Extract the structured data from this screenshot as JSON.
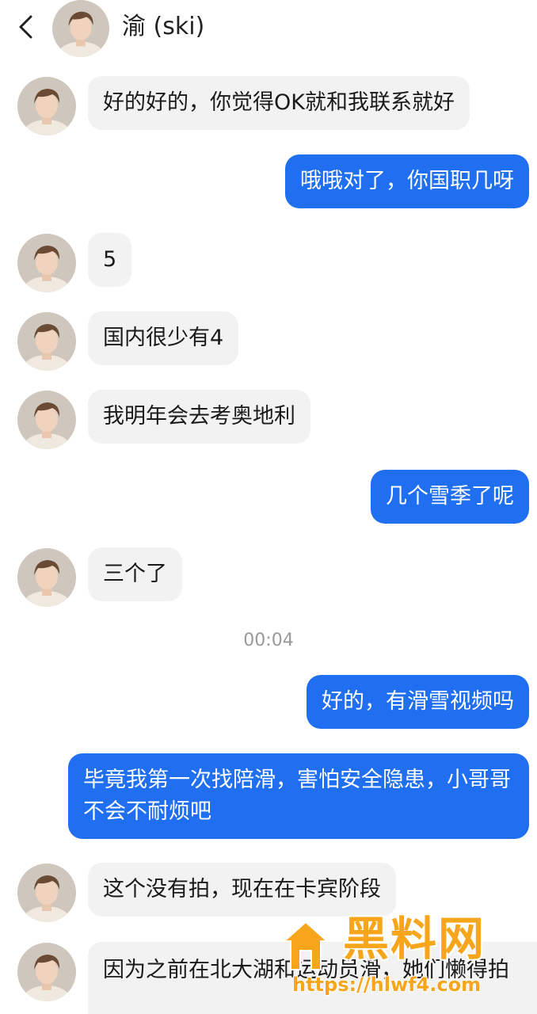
{
  "header": {
    "title": "渝 (ski)",
    "back_icon": "chevron-left-icon"
  },
  "colors": {
    "incoming_bubble": "#f2f2f2",
    "outgoing_bubble": "#1f6ff0"
  },
  "messages": [
    {
      "side": "in",
      "text": "好的好的，你觉得OK就和我联系就好"
    },
    {
      "side": "out",
      "text": "哦哦对了，你国职几呀"
    },
    {
      "side": "in",
      "text": "5"
    },
    {
      "side": "in",
      "text": "国内很少有4"
    },
    {
      "side": "in",
      "text": "我明年会去考奥地利"
    },
    {
      "side": "out",
      "text": "几个雪季了呢"
    },
    {
      "side": "in",
      "text": "三个了"
    },
    {
      "side": "out",
      "text": "好的，有滑雪视频吗"
    },
    {
      "side": "out",
      "text": "毕竟我第一次找陪滑，害怕安全隐患，小哥哥不会不耐烦吧"
    },
    {
      "side": "in",
      "text": "这个没有拍，现在在卡宾阶段"
    },
    {
      "side": "in",
      "text": "因为之前在北大湖和运动员滑，她们懒得拍"
    }
  ],
  "timestamp": "00:04",
  "watermark": {
    "brand": "黑料网",
    "url": "https://hlwf4.com"
  }
}
